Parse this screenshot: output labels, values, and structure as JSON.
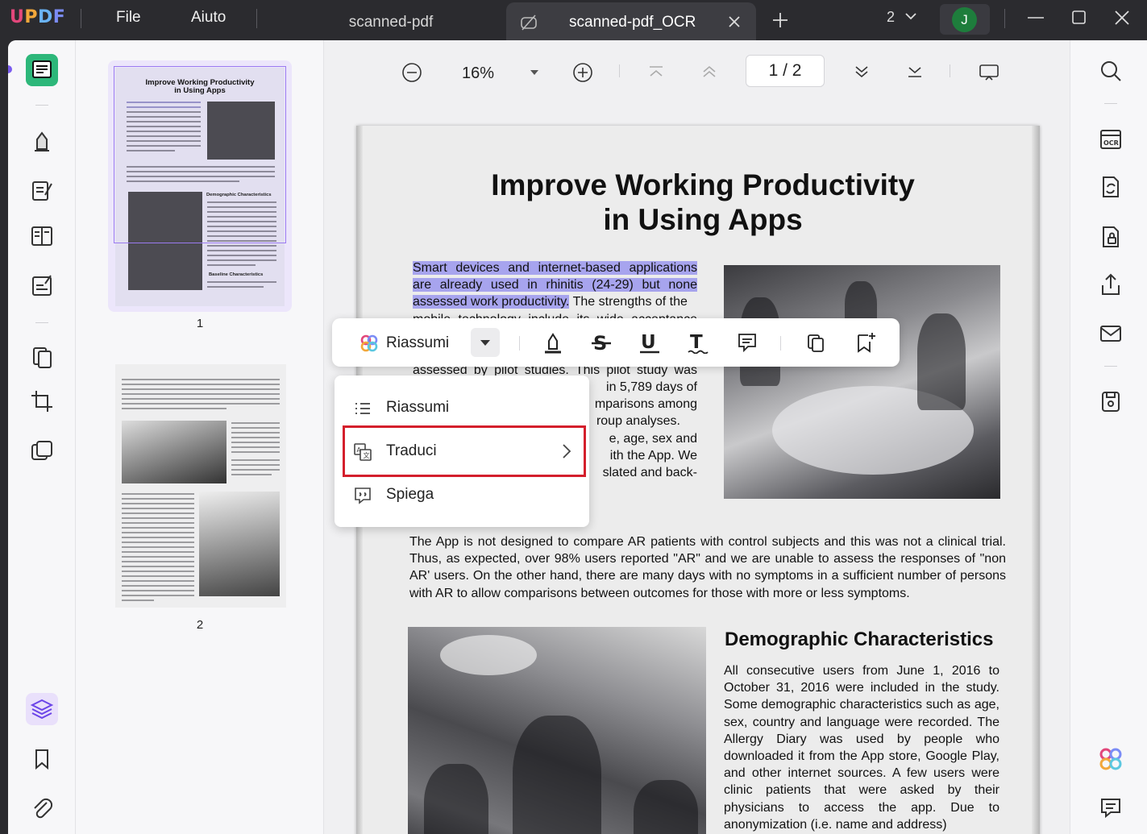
{
  "app": {
    "logo": "UPDF",
    "menu": [
      "File",
      "Aiuto"
    ],
    "tabs": [
      {
        "label": "scanned-pdf",
        "active": false
      },
      {
        "label": "scanned-pdf_OCR",
        "active": true
      }
    ],
    "window_count": "2",
    "user_initial": "J"
  },
  "toolbar": {
    "zoom": "16%",
    "page_current": "1",
    "page_total": "2",
    "page_display": "1 / 2"
  },
  "thumbnails": {
    "pages": [
      {
        "number": "1",
        "title_line1": "Improve Working Productivity",
        "title_line2": "in Using Apps",
        "head1": "Demographic Characteristics",
        "head2": "Baseline Characteristics"
      },
      {
        "number": "2"
      }
    ]
  },
  "document": {
    "title_line1": "Improve Working Productivity",
    "title_line2": "in Using Apps",
    "para1": {
      "selected_line1": "Smart devices and internet-based applications",
      "selected_line2": "are already used in rhinitis (24-29) but none",
      "selected_line3": "assessed work productivity.",
      "rest_line3": " The strengths of the",
      "hidden_line4": "mobile technology include its wide acceptance",
      "line5": "assessed by pilot studies. This pilot study was",
      "line6": "in 5,789 days of",
      "line7": "mparisons among",
      "line8": "roup analyses.",
      "line9": "e, age, sex and",
      "line10": "ith the App. We",
      "line11": "slated and back-"
    },
    "para2": "The App is not designed to compare AR patients with control subjects and this was not a clinical trial. Thus, as expected, over 98% users reported \"AR\" and we are unable to assess the responses of \"non AR' users. On the other hand, there are many days with no symptoms in a sufficient number of persons with AR to allow comparisons between outcomes for those with more or less symptoms.",
    "section_heading": "Demographic Characteristics",
    "para3": "All consecutive users from June 1, 2016 to October 31, 2016 were included in the study. Some demographic characteristics such as age, sex, country and language were recorded. The Allergy Diary was used by people who downloaded it from the App store, Google Play, and other internet sources. A few users were clinic patients that were asked by their physicians to access the app. Due to anonymization (i.e. name and address)"
  },
  "selection_toolbar": {
    "ai_label": "Riassumi",
    "tools": [
      "highlight-icon",
      "strikethrough-icon",
      "underline-icon",
      "squiggly-text-icon",
      "comment-icon",
      "copy-icon",
      "bookmark-add-icon"
    ]
  },
  "ai_menu": {
    "items": [
      {
        "label": "Riassumi",
        "icon": "list-icon"
      },
      {
        "label": "Traduci",
        "icon": "translate-icon",
        "has_submenu": true,
        "highlighted": true
      },
      {
        "label": "Spiega",
        "icon": "explain-icon"
      }
    ]
  },
  "colors": {
    "accent_green": "#2db77a",
    "selection": "#a7a4ee",
    "highlight_box": "#d41f2c",
    "purple": "#7b5cf0"
  }
}
